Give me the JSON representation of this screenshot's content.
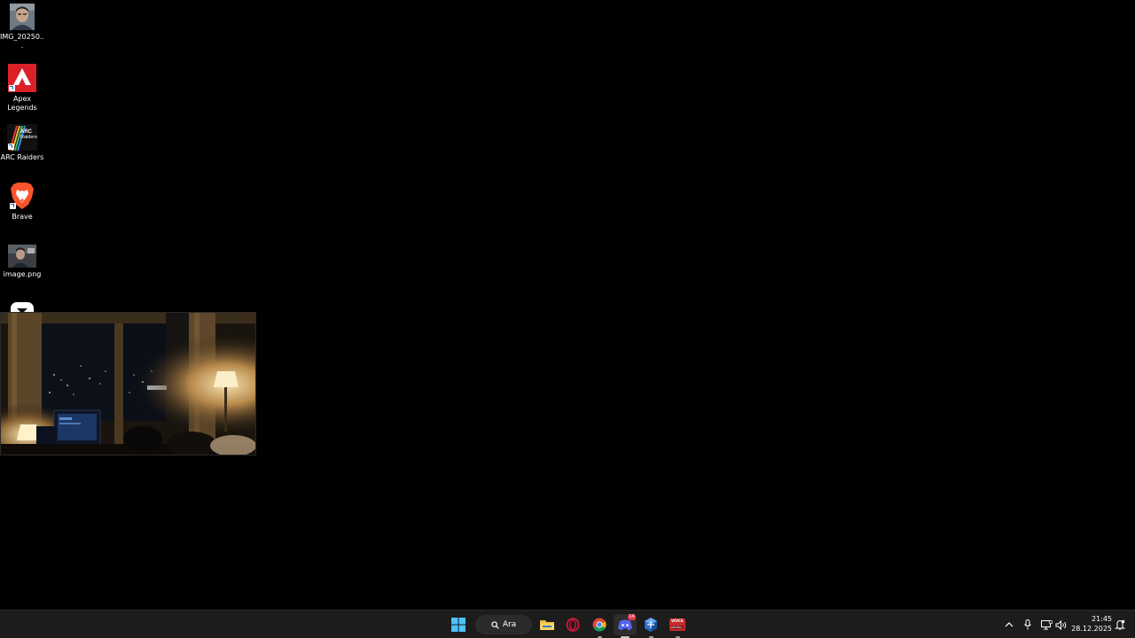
{
  "desktop": {
    "icons": [
      {
        "label": "IMG_20250...",
        "icon": "photo-thumbnail-icon"
      },
      {
        "label": "Apex Legends",
        "icon": "apex-legends-icon"
      },
      {
        "label": "ARC Raiders",
        "icon": "arc-raiders-icon",
        "badge": "ARC Raiders"
      },
      {
        "label": "Brave",
        "icon": "brave-lion-icon"
      },
      {
        "label": "image.png",
        "icon": "image-thumbnail-icon"
      },
      {
        "label": "",
        "icon": "partially-hidden-icon"
      }
    ]
  },
  "taskbar": {
    "search_label": "Ara",
    "apps": [
      {
        "name": "start",
        "icon": "windows-start-icon"
      },
      {
        "name": "file-explorer",
        "icon": "folder-icon",
        "running": false
      },
      {
        "name": "opera-gx",
        "icon": "opera-gx-icon",
        "running": false
      },
      {
        "name": "chrome",
        "icon": "chrome-icon",
        "running": true
      },
      {
        "name": "discord",
        "icon": "discord-icon",
        "running": true,
        "active": true,
        "badge": "14"
      },
      {
        "name": "app-settings",
        "icon": "blue-cube-icon",
        "running": true
      },
      {
        "name": "voice-app",
        "icon": "red-voice-icon",
        "running": true,
        "badge": "VOICE"
      }
    ],
    "tray": {
      "icons": [
        "chevron-up-icon",
        "microphone-icon",
        "network-icon",
        "speaker-icon",
        "notification-icon"
      ]
    },
    "clock": {
      "time": "21:45",
      "date": "28.12.2025"
    }
  },
  "colors": {
    "desktop_bg": "#000000",
    "taskbar_bg": "#1c1c1c",
    "windows_blue": "#4cc2ff",
    "apex_red": "#da2128",
    "brave_orange": "#fb542b"
  }
}
